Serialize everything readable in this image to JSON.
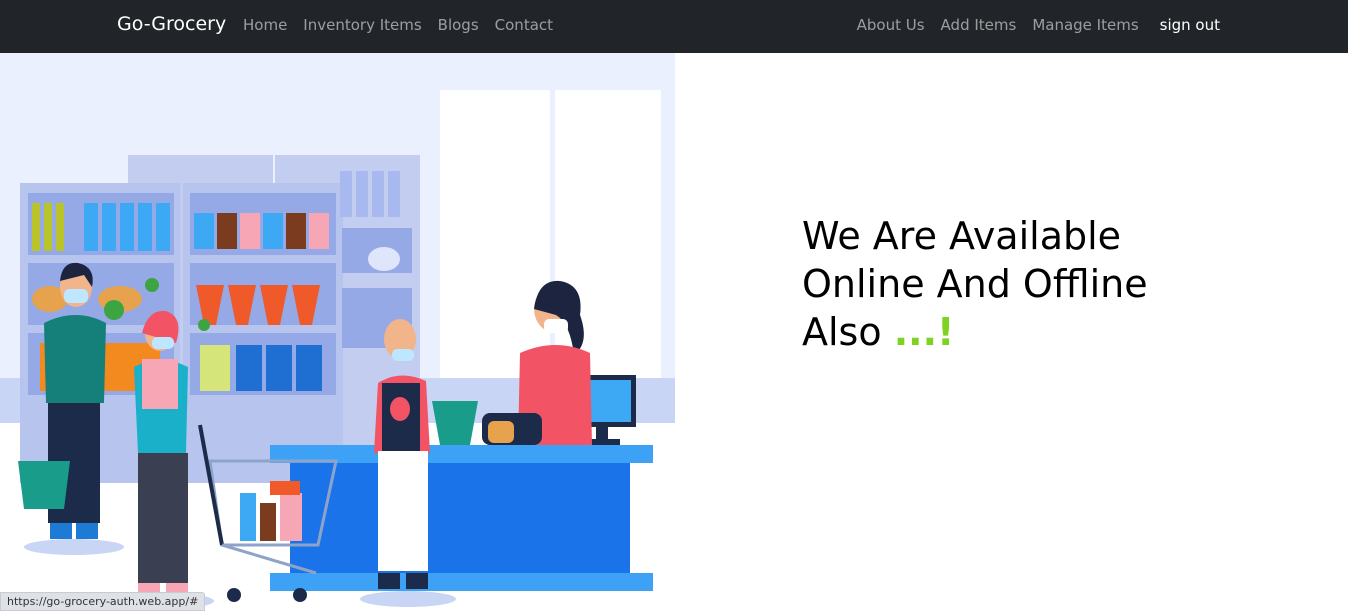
{
  "navbar": {
    "brand": "Go-Grocery",
    "left_links": [
      "Home",
      "Inventory Items",
      "Blogs",
      "Contact"
    ],
    "right_links": [
      "About Us",
      "Add Items",
      "Manage Items"
    ],
    "signout": "sign out"
  },
  "hero": {
    "line1": "We Are Available",
    "line2": "Online And Offline",
    "line3": "Also",
    "accent": "...!"
  },
  "status_bar": {
    "url": "https://go-grocery-auth.web.app/#"
  },
  "colors": {
    "navbar": "#212529",
    "accent": "#7ed321",
    "counter": "#1a73e8"
  },
  "icons": {
    "hero": "grocery-store-illustration"
  }
}
